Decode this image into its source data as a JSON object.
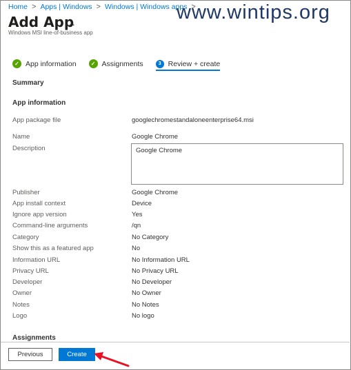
{
  "breadcrumb": {
    "items": [
      "Home",
      "Apps | Windows",
      "Windows | Windows apps"
    ],
    "separator": ">"
  },
  "watermark": "www.wintips.org",
  "page": {
    "title": "Add App",
    "more": "...",
    "subtitle": "Windows MSI line-of-business app"
  },
  "steps": [
    {
      "label": "App information",
      "state": "done",
      "icon": "check-icon"
    },
    {
      "label": "Assignments",
      "state": "done",
      "icon": "check-icon"
    },
    {
      "label": "Review + create",
      "state": "active",
      "number": "3"
    }
  ],
  "summary": {
    "heading": "Summary",
    "app_info_heading": "App information",
    "fields": [
      {
        "label": "App package file",
        "value": "googlechromestandaloneenterprise64.msi"
      },
      {
        "label": "Name",
        "value": "Google Chrome"
      },
      {
        "label": "Description",
        "value": "Google Chrome"
      },
      {
        "label": "Publisher",
        "value": "Google Chrome"
      },
      {
        "label": "App install context",
        "value": "Device"
      },
      {
        "label": "Ignore app version",
        "value": "Yes"
      },
      {
        "label": "Command-line arguments",
        "value": "/qn"
      },
      {
        "label": "Category",
        "value": "No Category"
      },
      {
        "label": "Show this as a featured app",
        "value": "No"
      },
      {
        "label": "Information URL",
        "value": "No Information URL"
      },
      {
        "label": "Privacy URL",
        "value": "No Privacy URL"
      },
      {
        "label": "Developer",
        "value": "No Developer"
      },
      {
        "label": "Owner",
        "value": "No Owner"
      },
      {
        "label": "Notes",
        "value": "No Notes"
      },
      {
        "label": "Logo",
        "value": "No logo"
      }
    ],
    "assignments_heading": "Assignments"
  },
  "footer": {
    "previous_label": "Previous",
    "create_label": "Create"
  },
  "colors": {
    "accent": "#0078d4",
    "success": "#57a300",
    "arrow": "#e81123",
    "watermark": "#1f3864"
  }
}
